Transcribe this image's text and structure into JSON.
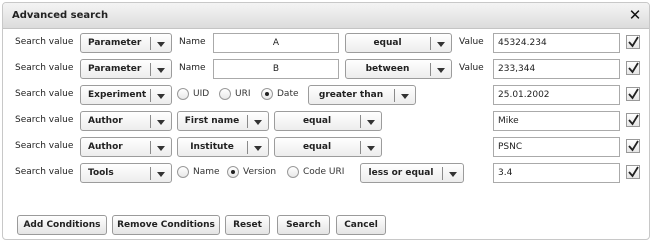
{
  "dialog": {
    "title": "Advanced search",
    "close_icon": "close-icon"
  },
  "search_label": "Search value",
  "rows": [
    {
      "type": "Parameter",
      "name_label": "Name",
      "name_value": "A",
      "operator": "equal",
      "value_label": "Value",
      "value": "45324.234",
      "checked": true
    },
    {
      "type": "Parameter",
      "name_label": "Name",
      "name_value": "B",
      "operator": "between",
      "value_label": "Value",
      "value": "233,344",
      "checked": true
    },
    {
      "type": "Experiment",
      "radios": [
        "UID",
        "URI",
        "Date"
      ],
      "selected_radio": "Date",
      "operator": "greater than",
      "value": "25.01.2002",
      "checked": true
    },
    {
      "type": "Author",
      "field": "First name",
      "operator": "equal",
      "value": "Mike",
      "checked": true
    },
    {
      "type": "Author",
      "field": "Institute",
      "operator": "equal",
      "value": "PSNC",
      "checked": true
    },
    {
      "type": "Tools",
      "radios": [
        "Name",
        "Version",
        "Code URI"
      ],
      "selected_radio": "Version",
      "operator": "less or equal",
      "value": "3.4",
      "checked": true
    }
  ],
  "buttons": {
    "add": "Add Conditions",
    "remove": "Remove Conditions",
    "reset": "Reset",
    "search": "Search",
    "cancel": "Cancel"
  }
}
